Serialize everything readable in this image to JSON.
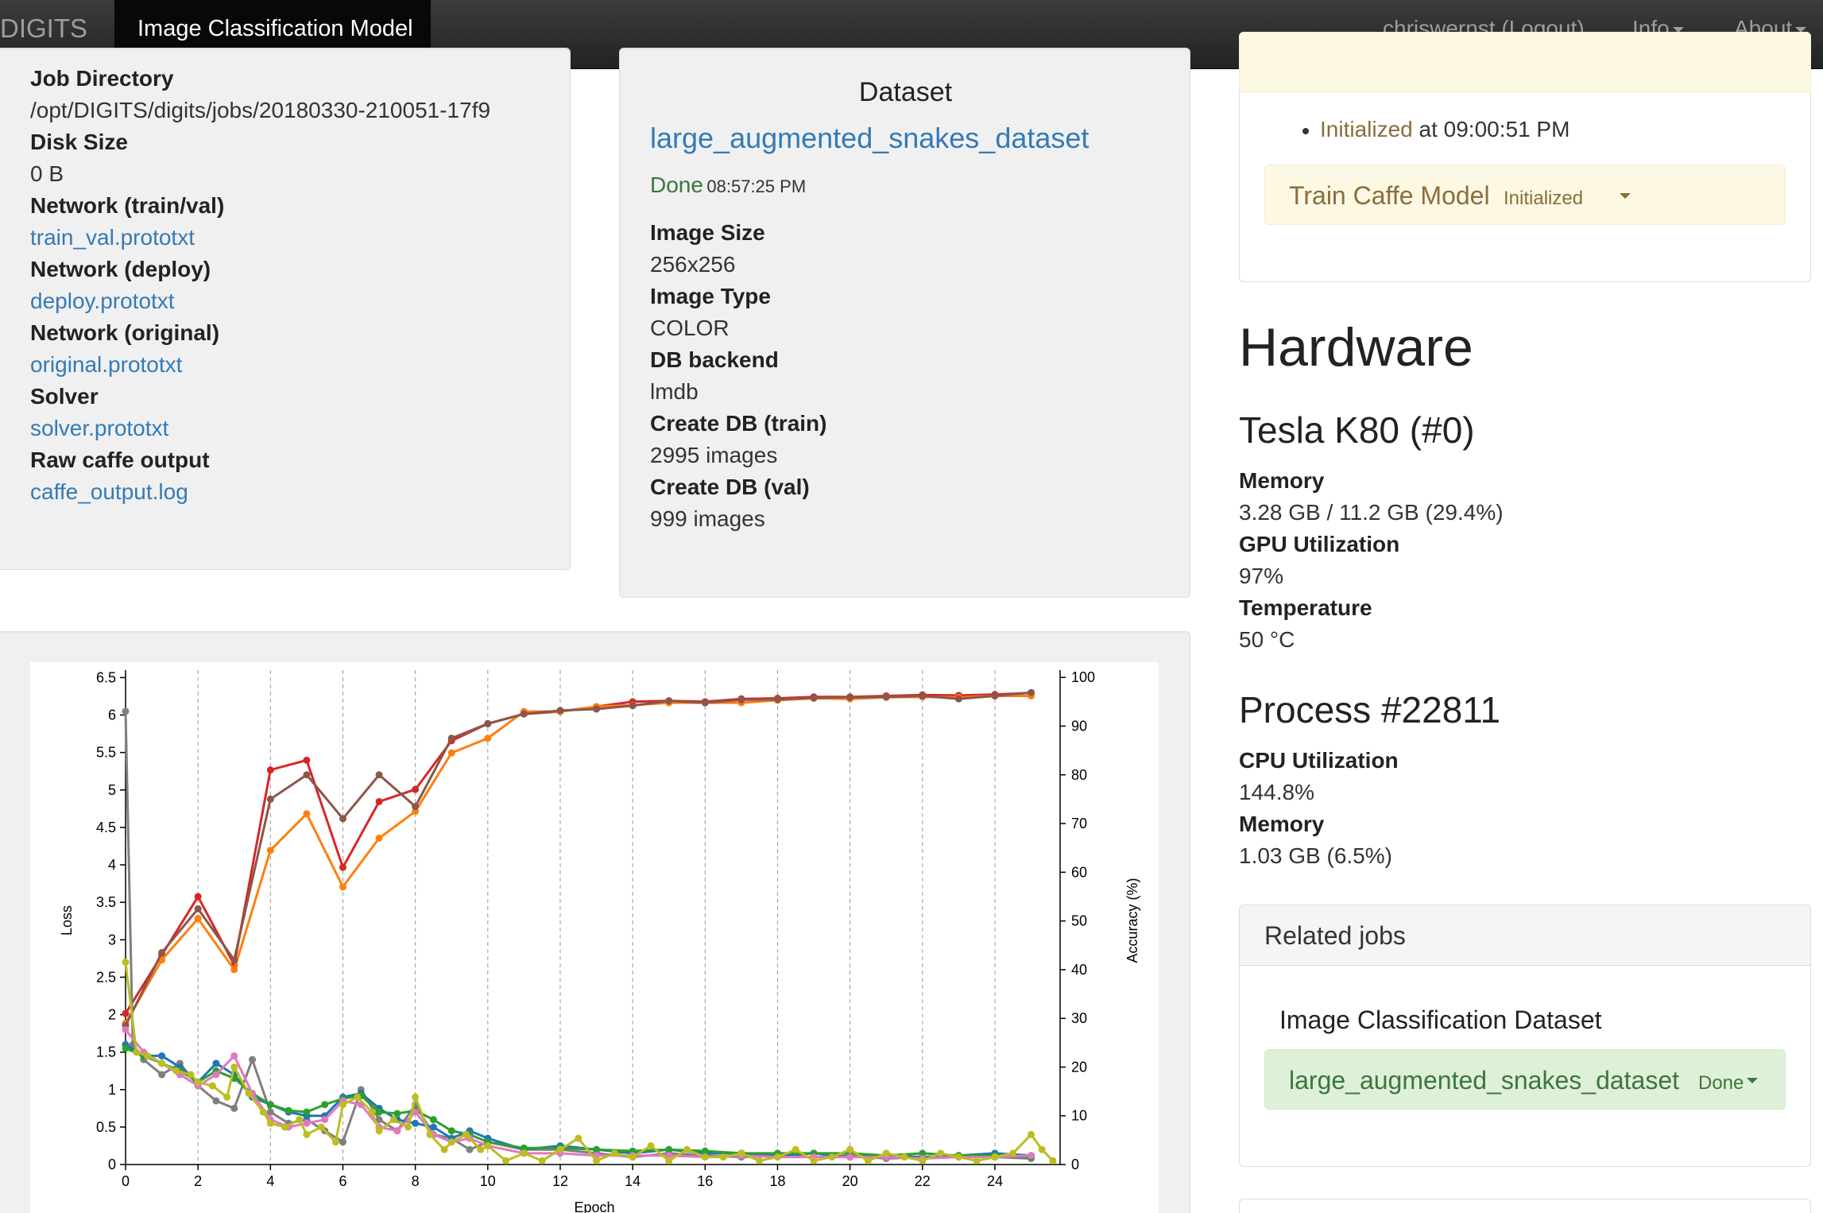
{
  "navbar": {
    "brand": "DIGITS",
    "active_tab": "Image Classification Model",
    "user": "chriswernst (Logout)",
    "info": "Info",
    "about": "About"
  },
  "job": {
    "items": [
      {
        "label": "Job Directory",
        "value": "/opt/DIGITS/digits/jobs/20180330-210051-17f9",
        "link": false
      },
      {
        "label": "Disk Size",
        "value": "0 B",
        "link": false
      },
      {
        "label": "Network (train/val)",
        "value": "train_val.prototxt",
        "link": true
      },
      {
        "label": "Network (deploy)",
        "value": "deploy.prototxt",
        "link": true
      },
      {
        "label": "Network (original)",
        "value": "original.prototxt",
        "link": true
      },
      {
        "label": "Solver",
        "value": "solver.prototxt",
        "link": true
      },
      {
        "label": "Raw caffe output",
        "value": "caffe_output.log",
        "link": true
      }
    ]
  },
  "dataset": {
    "heading": "Dataset",
    "name": "large_augmented_snakes_dataset",
    "status": "Done",
    "status_time": "08:57:25 PM",
    "items": [
      {
        "label": "Image Size",
        "value": "256x256"
      },
      {
        "label": "Image Type",
        "value": "COLOR"
      },
      {
        "label": "DB backend",
        "value": "lmdb"
      },
      {
        "label": "Create DB (train)",
        "value": "2995 images"
      },
      {
        "label": "Create DB (val)",
        "value": "999 images"
      }
    ]
  },
  "job_status": {
    "status_word": "Initialized",
    "status_at": "at 09:00:51 PM",
    "task_name": "Train Caffe Model",
    "task_status": "Initialized"
  },
  "hardware": {
    "heading": "Hardware",
    "gpu_name": "Tesla K80 (#0)",
    "gpu_items": [
      {
        "label": "Memory",
        "value": "3.28 GB / 11.2 GB (29.4%)"
      },
      {
        "label": "GPU Utilization",
        "value": "97%"
      },
      {
        "label": "Temperature",
        "value": "50 °C"
      }
    ],
    "process_name": "Process #22811",
    "process_items": [
      {
        "label": "CPU Utilization",
        "value": "144.8%"
      },
      {
        "label": "Memory",
        "value": "1.03 GB (6.5%)"
      }
    ]
  },
  "related": {
    "heading": "Related jobs",
    "type": "Image Classification Dataset",
    "job_name": "large_augmented_snakes_dataset",
    "job_status": "Done"
  },
  "chart_data": {
    "type": "line",
    "xlabel": "Epoch",
    "ylabel": "Loss",
    "y2label": "Accuracy (%)",
    "xlim": [
      0,
      25.8
    ],
    "ylim": [
      0,
      6.6
    ],
    "y2lim": [
      0,
      101.5
    ],
    "xticks": [
      0,
      2,
      4,
      6,
      8,
      10,
      12,
      14,
      16,
      18,
      20,
      22,
      24
    ],
    "yticks": [
      0,
      0.5,
      1,
      1.5,
      2,
      2.5,
      3,
      3.5,
      4,
      4.5,
      5,
      5.5,
      6,
      6.5
    ],
    "y2ticks": [
      0,
      10,
      20,
      30,
      40,
      50,
      60,
      70,
      80,
      90,
      100
    ],
    "grid": "vertical dashed",
    "series": [
      {
        "color": "#d62728",
        "axis": "right",
        "x": [
          0,
          1,
          2,
          3,
          4,
          5,
          6,
          7,
          8,
          9,
          10,
          11,
          12,
          13,
          14,
          15,
          16,
          17,
          18,
          19,
          20,
          21,
          22,
          23,
          24,
          25
        ],
        "y": [
          31,
          43,
          55,
          41,
          81,
          83,
          61,
          74.5,
          77,
          87,
          90.5,
          92.5,
          93,
          94,
          95,
          95.2,
          95,
          95.6,
          95.7,
          96,
          96,
          96.2,
          96.4,
          96.3,
          96.5,
          96.8
        ]
      },
      {
        "color": "#ff7f0e",
        "axis": "right",
        "x": [
          0,
          1,
          2,
          3,
          4,
          5,
          6,
          7,
          8,
          9,
          10,
          11,
          12,
          13,
          14,
          15,
          16,
          17,
          18,
          19,
          20,
          21,
          22,
          23,
          24,
          25
        ],
        "y": [
          29,
          42,
          50.5,
          40,
          64.5,
          72,
          57,
          67,
          72.5,
          84.5,
          87.5,
          93,
          93,
          94,
          94.3,
          94.8,
          94.8,
          94.8,
          95.3,
          95.7,
          95.6,
          95.9,
          96,
          95.9,
          96.2,
          96.2
        ]
      },
      {
        "color": "#8c564b",
        "axis": "right",
        "x": [
          0,
          1,
          2,
          3,
          4,
          5,
          6,
          7,
          8,
          9,
          10,
          11,
          12,
          13,
          14,
          15,
          16,
          17,
          18,
          19,
          20,
          21,
          22,
          23,
          24,
          25
        ],
        "y": [
          28.5,
          43.5,
          52.5,
          42,
          75,
          80,
          71,
          80,
          73.5,
          87.5,
          90.5,
          92.5,
          93.2,
          93.5,
          94.2,
          95.2,
          94.8,
          95.4,
          95.5,
          95.8,
          95.9,
          96,
          96.2,
          95.6,
          96.2,
          96.9
        ]
      },
      {
        "color": "#7f7f7f",
        "axis": "left",
        "x": [
          0,
          0.2,
          0.5,
          1,
          1.5,
          2,
          2.5,
          3,
          3.5,
          4,
          4.5,
          5,
          5.5,
          6,
          6.5,
          7,
          7.5,
          8,
          8.5,
          9,
          9.5,
          10,
          11,
          12,
          13,
          14,
          15,
          16,
          17,
          18,
          19,
          20,
          21,
          22,
          23,
          24,
          25
        ],
        "y": [
          6.05,
          1.6,
          1.4,
          1.2,
          1.35,
          1.05,
          0.85,
          0.75,
          1.4,
          0.7,
          0.55,
          0.6,
          0.45,
          0.3,
          1.0,
          0.6,
          0.45,
          0.8,
          0.4,
          0.35,
          0.2,
          0.3,
          0.2,
          0.2,
          0.15,
          0.1,
          0.15,
          0.12,
          0.1,
          0.12,
          0.1,
          0.12,
          0.08,
          0.1,
          0.12,
          0.1,
          0.08
        ]
      },
      {
        "color": "#1f77b4",
        "axis": "left",
        "x": [
          0,
          0.5,
          1,
          1.5,
          2,
          2.5,
          3,
          3.5,
          4,
          4.5,
          5,
          5.5,
          6,
          6.5,
          7,
          7.5,
          8,
          8.5,
          9,
          9.5,
          10,
          11,
          12,
          13,
          14,
          15,
          16,
          17,
          18,
          19,
          20,
          21,
          22,
          23,
          24,
          25
        ],
        "y": [
          1.6,
          1.45,
          1.45,
          1.3,
          1.1,
          1.35,
          1.2,
          0.9,
          0.8,
          0.7,
          0.65,
          0.65,
          0.9,
          0.95,
          0.75,
          0.6,
          0.55,
          0.5,
          0.35,
          0.45,
          0.35,
          0.2,
          0.25,
          0.2,
          0.15,
          0.2,
          0.15,
          0.15,
          0.12,
          0.15,
          0.1,
          0.12,
          0.1,
          0.12,
          0.15,
          0.12
        ]
      },
      {
        "color": "#2ca02c",
        "axis": "left",
        "x": [
          0,
          0.5,
          1,
          1.5,
          2,
          2.5,
          3,
          3.5,
          4,
          4.5,
          5,
          5.5,
          6,
          6.5,
          7,
          7.5,
          8,
          8.5,
          9,
          9.5,
          10,
          11,
          12,
          13,
          14,
          15,
          16,
          17,
          18,
          19,
          20,
          21,
          22,
          23,
          24,
          25
        ],
        "y": [
          1.55,
          1.45,
          1.35,
          1.25,
          1.1,
          1.25,
          1.15,
          0.95,
          0.8,
          0.72,
          0.7,
          0.8,
          0.88,
          0.92,
          0.7,
          0.68,
          0.72,
          0.6,
          0.45,
          0.4,
          0.3,
          0.22,
          0.22,
          0.2,
          0.18,
          0.2,
          0.18,
          0.15,
          0.15,
          0.15,
          0.15,
          0.12,
          0.15,
          0.12,
          0.12,
          0.1
        ]
      },
      {
        "color": "#e377c2",
        "axis": "left",
        "x": [
          0,
          0.5,
          1,
          1.5,
          2,
          2.5,
          3,
          3.5,
          4,
          4.5,
          5,
          5.5,
          6,
          6.5,
          7,
          7.5,
          8,
          8.5,
          9,
          9.5,
          10,
          11,
          12,
          13,
          14,
          15,
          16,
          17,
          18,
          19,
          20,
          21,
          22,
          23,
          24,
          25
        ],
        "y": [
          1.8,
          1.5,
          1.35,
          1.2,
          1.05,
          1.2,
          1.45,
          0.95,
          0.6,
          0.5,
          0.55,
          0.6,
          0.85,
          0.8,
          0.5,
          0.45,
          0.7,
          0.4,
          0.3,
          0.35,
          0.25,
          0.15,
          0.15,
          0.12,
          0.12,
          0.12,
          0.1,
          0.12,
          0.1,
          0.1,
          0.1,
          0.1,
          0.08,
          0.1,
          0.1,
          0.12
        ]
      },
      {
        "color": "#bcbd22",
        "axis": "left",
        "x": [
          0,
          0.3,
          0.6,
          1,
          1.4,
          1.8,
          2,
          2.4,
          2.8,
          3,
          3.4,
          3.8,
          4,
          4.4,
          4.8,
          5,
          5.4,
          5.8,
          6,
          6.4,
          6.8,
          7,
          7.4,
          7.8,
          8,
          8.4,
          8.8,
          9,
          9.4,
          9.8,
          10,
          10.5,
          11,
          11.5,
          12,
          12.5,
          13,
          13.5,
          14,
          14.5,
          15,
          15.5,
          16,
          16.5,
          17,
          17.5,
          18,
          18.5,
          19,
          19.5,
          20,
          20.5,
          21,
          21.5,
          22,
          22.5,
          23,
          23.5,
          24,
          24.5,
          25,
          25.3,
          25.6
        ],
        "y": [
          2.7,
          1.5,
          1.45,
          1.35,
          1.25,
          1.2,
          1.1,
          1.05,
          0.9,
          1.3,
          0.95,
          0.7,
          0.55,
          0.5,
          0.6,
          0.4,
          0.5,
          0.3,
          0.8,
          0.9,
          0.7,
          0.45,
          0.6,
          0.5,
          0.9,
          0.4,
          0.2,
          0.3,
          0.4,
          0.2,
          0.25,
          0.05,
          0.15,
          0.05,
          0.2,
          0.35,
          0.05,
          0.15,
          0.1,
          0.25,
          0.05,
          0.2,
          0.1,
          0.1,
          0.15,
          0.05,
          0.1,
          0.2,
          0.05,
          0.1,
          0.2,
          0.05,
          0.15,
          0.1,
          0.05,
          0.15,
          0.1,
          0.05,
          0.1,
          0.15,
          0.4,
          0.2,
          0.05
        ]
      }
    ]
  }
}
